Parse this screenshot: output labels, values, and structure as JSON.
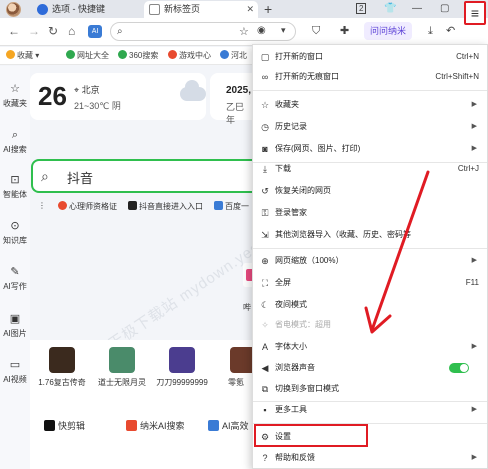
{
  "tabs": [
    {
      "title": "选项 - 快捷键"
    },
    {
      "title": "新标签页"
    }
  ],
  "toolbar": {
    "search_placeholder": "",
    "tab_count": "2",
    "ai_label": "问问纳米",
    "menu_icon": "hamburger-icon"
  },
  "bookmarks": [
    {
      "label": "收藏",
      "color": "#f5a623"
    },
    {
      "label": "网址大全",
      "color": "#2fa84f"
    },
    {
      "label": "360搜索",
      "color": "#2fa84f"
    },
    {
      "label": "游戏中心",
      "color": "#e84a2f"
    },
    {
      "label": "河北",
      "color": "#3a7bd5"
    }
  ],
  "sidebar": [
    {
      "label": "收藏夹",
      "icon": "star-icon"
    },
    {
      "label": "AI搜索",
      "icon": "search-icon"
    },
    {
      "label": "智能体",
      "icon": "robot-icon"
    },
    {
      "label": "知识库",
      "icon": "bulb-icon"
    },
    {
      "label": "AI写作",
      "icon": "pen-icon"
    },
    {
      "label": "AI图片",
      "icon": "image-icon"
    },
    {
      "label": "AI视频",
      "icon": "video-icon"
    }
  ],
  "weather": {
    "temp": "26",
    "city": "北京",
    "range": "21~30℃ 阴",
    "year": "2025,",
    "lunar": "乙巳年"
  },
  "search": {
    "query": "抖音"
  },
  "hot": [
    {
      "label": "心理师资格证",
      "color": "#e84a2f"
    },
    {
      "label": "抖音直接进入入口",
      "color": "#222"
    },
    {
      "label": "百度一",
      "color": "#3a7bd5"
    }
  ],
  "shortcut_label": "哔",
  "games": [
    {
      "label": "1.76复古传奇",
      "color": "#3b2a1e"
    },
    {
      "label": "道士无限月灵",
      "color": "#4a8b6a"
    },
    {
      "label": "刀刀99999999",
      "color": "#4b3d8f"
    },
    {
      "label": "零氪",
      "color": "#6b3a2a"
    }
  ],
  "tools": [
    {
      "label": "快剪辑",
      "color": "#111"
    },
    {
      "label": "纳米AI搜索",
      "color": "#e84a2f"
    },
    {
      "label": "AI高效",
      "color": "#3a7bd5"
    }
  ],
  "watermark": "天极下载站 mydown.yesky.com",
  "menu": {
    "new_window": {
      "label": "打开新的窗口",
      "shortcut": "Ctrl+N"
    },
    "new_incognito": {
      "label": "打开新的无痕窗口",
      "shortcut": "Ctrl+Shift+N"
    },
    "favorites": {
      "label": "收藏夹"
    },
    "history": {
      "label": "历史记录"
    },
    "save": {
      "label": "保存(网页、图片、打印)"
    },
    "download": {
      "label": "下载",
      "shortcut": "Ctrl+J"
    },
    "restore": {
      "label": "恢复关闭的网页"
    },
    "login": {
      "label": "登录管家"
    },
    "import": {
      "label": "其他浏览器导入（收藏、历史、密码等"
    },
    "zoom": {
      "label": "网页缩放（100%）"
    },
    "fullscreen": {
      "label": "全屏",
      "shortcut": "F11"
    },
    "night": {
      "label": "夜间模式"
    },
    "power_save": {
      "label": "省电模式：超用"
    },
    "font_size": {
      "label": "字体大小"
    },
    "sound": {
      "label": "浏览器声音"
    },
    "multi_window": {
      "label": "切换到多窗口模式"
    },
    "more_tools": {
      "label": "更多工具"
    },
    "settings": {
      "label": "设置"
    },
    "help": {
      "label": "帮助和反馈"
    }
  }
}
